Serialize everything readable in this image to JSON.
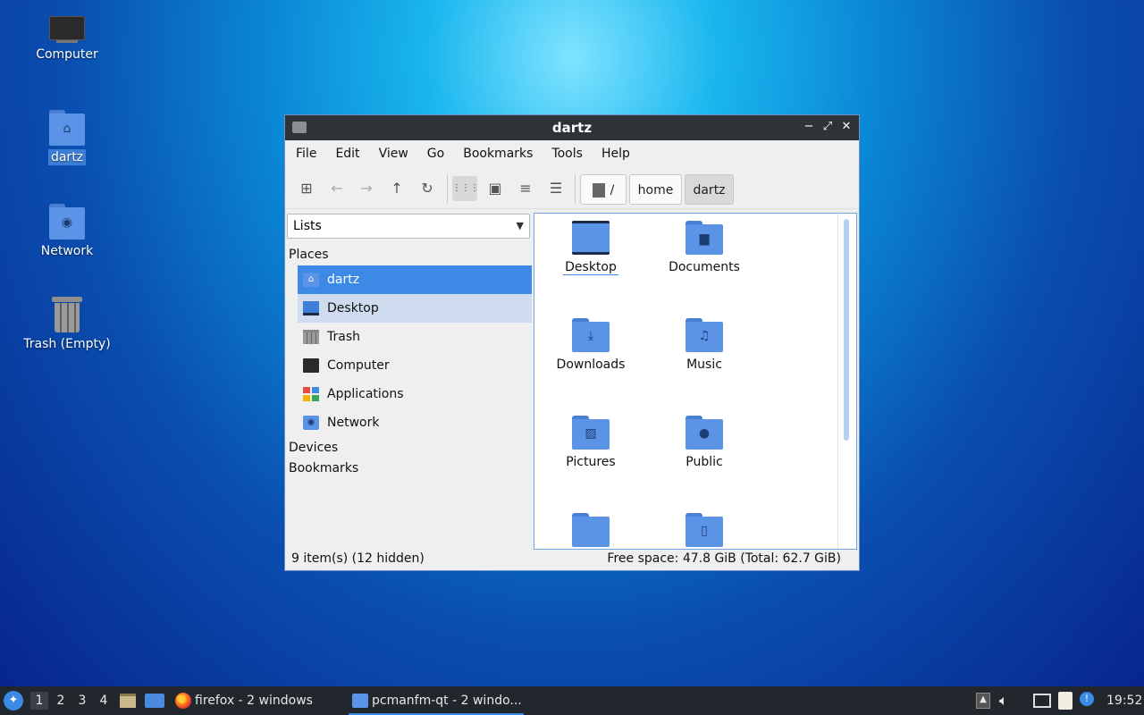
{
  "desktop": {
    "icons": [
      {
        "label": "Computer"
      },
      {
        "label": "dartz"
      },
      {
        "label": "Network"
      },
      {
        "label": "Trash (Empty)"
      }
    ]
  },
  "window": {
    "title": "dartz",
    "controls": {
      "minimize": "−",
      "maximize": "⤢",
      "close": "✕"
    },
    "menu": [
      "File",
      "Edit",
      "View",
      "Go",
      "Bookmarks",
      "Tools",
      "Help"
    ],
    "toolbar": {
      "new_tab": "⊞",
      "back": "←",
      "forward": "→",
      "up": "↑",
      "reload": "↻",
      "icon_view": "⋮⋮⋮",
      "thumbnail_view": "▣",
      "compact_view": "≡",
      "detailed_view": "☰",
      "active_view": "icon"
    },
    "path": {
      "root": "/",
      "segments": [
        "home",
        "dartz"
      ]
    },
    "sidebar": {
      "selector": "Lists",
      "places_header": "Places",
      "places": [
        {
          "label": "dartz",
          "icon": "home-folder-icon",
          "state": "selected"
        },
        {
          "label": "Desktop",
          "icon": "desktop-icon",
          "state": "hover"
        },
        {
          "label": "Trash",
          "icon": "trash-icon"
        },
        {
          "label": "Computer",
          "icon": "computer-icon"
        },
        {
          "label": "Applications",
          "icon": "applications-icon"
        },
        {
          "label": "Network",
          "icon": "network-folder-icon"
        }
      ],
      "devices_header": "Devices",
      "bookmarks_header": "Bookmarks"
    },
    "files": [
      {
        "label": "Desktop",
        "glyph": ""
      },
      {
        "label": "Documents",
        "glyph": "▆"
      },
      {
        "label": "Downloads",
        "glyph": "⤓"
      },
      {
        "label": "Music",
        "glyph": "♫"
      },
      {
        "label": "Pictures",
        "glyph": "▨"
      },
      {
        "label": "Public",
        "glyph": "●"
      },
      {
        "label": "",
        "glyph": ""
      },
      {
        "label": "",
        "glyph": "▯"
      }
    ],
    "status": {
      "left": "9 item(s) (12 hidden)",
      "right": "Free space: 47.8 GiB (Total: 62.7 GiB)"
    }
  },
  "taskbar": {
    "workspaces": [
      "1",
      "2",
      "3",
      "4"
    ],
    "tasks": [
      {
        "label": "firefox - 2 windows"
      },
      {
        "label": "pcmanfm-qt - 2 windo..."
      }
    ],
    "clock": "19:52"
  },
  "colors": {
    "accent": "#3d8ae6",
    "folder": "#5b94e6",
    "titlebar": "#2f3338",
    "taskbar": "#22262d"
  }
}
